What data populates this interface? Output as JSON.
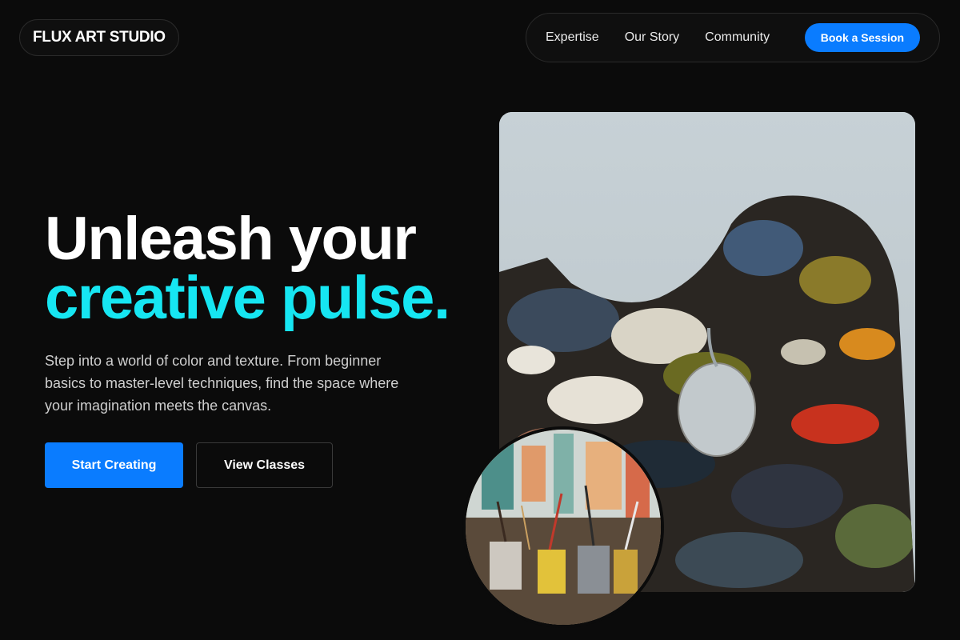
{
  "brand": {
    "name": "FLUX ART STUDIO"
  },
  "nav": {
    "links": [
      "Expertise",
      "Our Story",
      "Community"
    ],
    "cta_label": "Book a Session"
  },
  "hero": {
    "title_line1": "Unleash your",
    "title_line2": "creative pulse.",
    "description": "Step into a world of color and texture. From beginner basics to master-level techniques, find the space where your imagination meets the canvas.",
    "primary_button": "Start Creating",
    "secondary_button": "View Classes"
  },
  "colors": {
    "background": "#0b0b0b",
    "accent_blue": "#0a7cff",
    "accent_cyan": "#16e6f2"
  },
  "images": {
    "main": "paint-palette-photo",
    "inset": "art-brushes-jars-photo"
  }
}
